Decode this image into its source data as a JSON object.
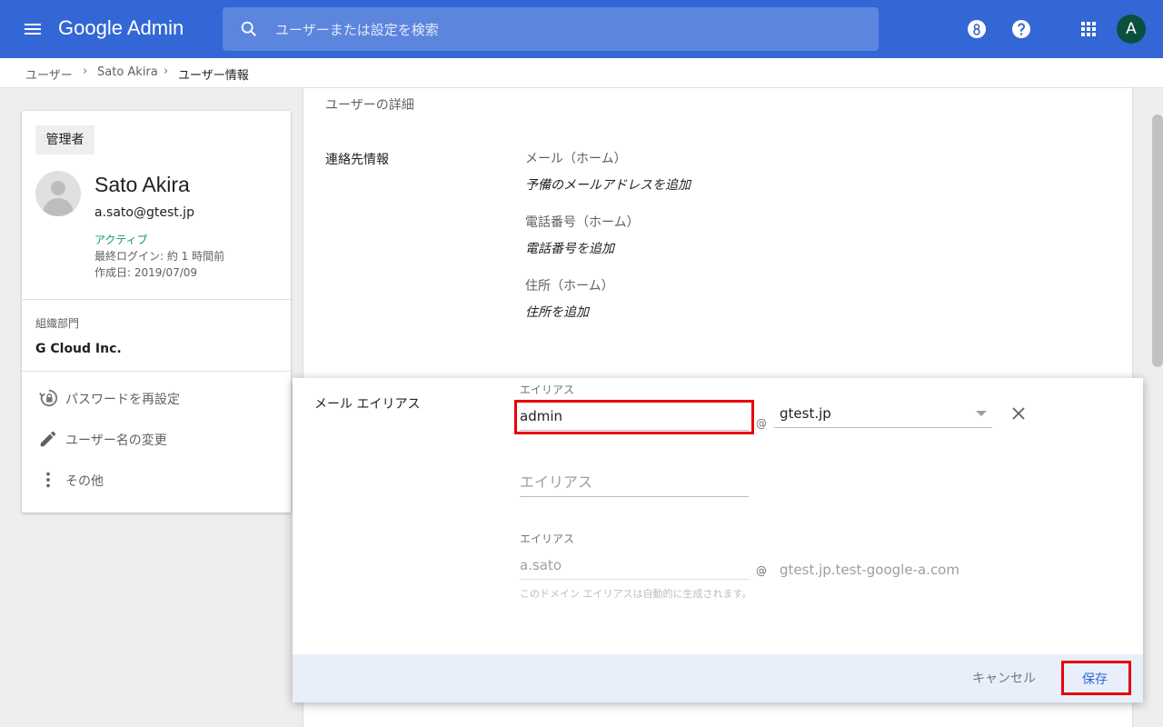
{
  "app": {
    "title": "Google Admin"
  },
  "search": {
    "placeholder": "ユーザーまたは設定を検索"
  },
  "topbar": {
    "icons": [
      "menu-icon",
      "search-icon",
      "support-icon",
      "help-icon",
      "apps-grid-icon"
    ],
    "avatar_letter": "A"
  },
  "breadcrumb": {
    "items": [
      "ユーザー",
      "Sato Akira",
      "ユーザー情報"
    ]
  },
  "user_card": {
    "role": "管理者",
    "name": "Sato Akira",
    "email": "a.sato@gtest.jp",
    "status": "アクティブ",
    "last_login": "最終ログイン: 約 1 時間前",
    "created": "作成日: 2019/07/09",
    "org_label": "組織部門",
    "org_value": "G Cloud Inc.",
    "actions": [
      {
        "label": "パスワードを再設定",
        "icon": "lock-reset-icon"
      },
      {
        "label": "ユーザー名の変更",
        "icon": "pencil-icon"
      },
      {
        "label": "その他",
        "icon": "more-vert-icon"
      }
    ]
  },
  "details": {
    "section_title": "ユーザーの詳細",
    "contact_label": "連絡先情報",
    "fields": [
      {
        "label": "メール（ホーム）",
        "add": "予備のメールアドレスを追加"
      },
      {
        "label": "電話番号（ホーム）",
        "add": "電話番号を追加"
      },
      {
        "label": "住所（ホーム）",
        "add": "住所を追加"
      }
    ]
  },
  "alias_dialog": {
    "title": "メール エイリアス",
    "alias_label": "エイリアス",
    "alias_value": "admin",
    "at": "@",
    "domain": "gtest.jp",
    "new_alias_placeholder": "エイリアス",
    "auto_alias_label": "エイリアス",
    "auto_alias_value": "a.sato",
    "auto_domain": "gtest.jp.test-google-a.com",
    "hint": "このドメイン エイリアスは自動的に生成されます。",
    "cancel": "キャンセル",
    "save": "保存"
  },
  "colors": {
    "primary": "#3367d6",
    "active_status": "#0f9d58",
    "highlight": "#e8000b",
    "footer_bg": "#e8effb"
  }
}
